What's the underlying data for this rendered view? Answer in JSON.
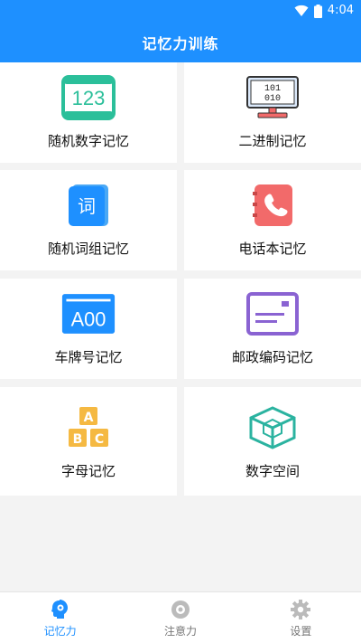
{
  "status_bar": {
    "time": "4:04"
  },
  "app": {
    "title": "记忆力训练"
  },
  "tiles": [
    {
      "label": "随机数字记忆",
      "icon": "number-123-icon",
      "icon_text": "123"
    },
    {
      "label": "二进制记忆",
      "icon": "binary-monitor-icon",
      "icon_text_row1": "101",
      "icon_text_row2": "010"
    },
    {
      "label": "随机词组记忆",
      "icon": "word-book-icon",
      "icon_text": "词"
    },
    {
      "label": "电话本记忆",
      "icon": "phone-book-icon"
    },
    {
      "label": "车牌号记忆",
      "icon": "license-plate-icon",
      "icon_text": "A00"
    },
    {
      "label": "邮政编码记忆",
      "icon": "postal-code-icon"
    },
    {
      "label": "字母记忆",
      "icon": "abc-blocks-icon",
      "icon_text_a": "A",
      "icon_text_b": "B",
      "icon_text_c": "C"
    },
    {
      "label": "数字空间",
      "icon": "cube-space-icon"
    }
  ],
  "bottom_nav": [
    {
      "label": "记忆力",
      "icon": "brain-head-icon",
      "active": true
    },
    {
      "label": "注意力",
      "icon": "focus-target-icon",
      "active": false
    },
    {
      "label": "设置",
      "icon": "gear-icon",
      "active": false
    }
  ],
  "colors": {
    "primary": "#1e90ff",
    "teal": "#2bbf9a",
    "coral": "#f26a6a",
    "purple": "#8a63d2",
    "orange": "#f5b942"
  }
}
